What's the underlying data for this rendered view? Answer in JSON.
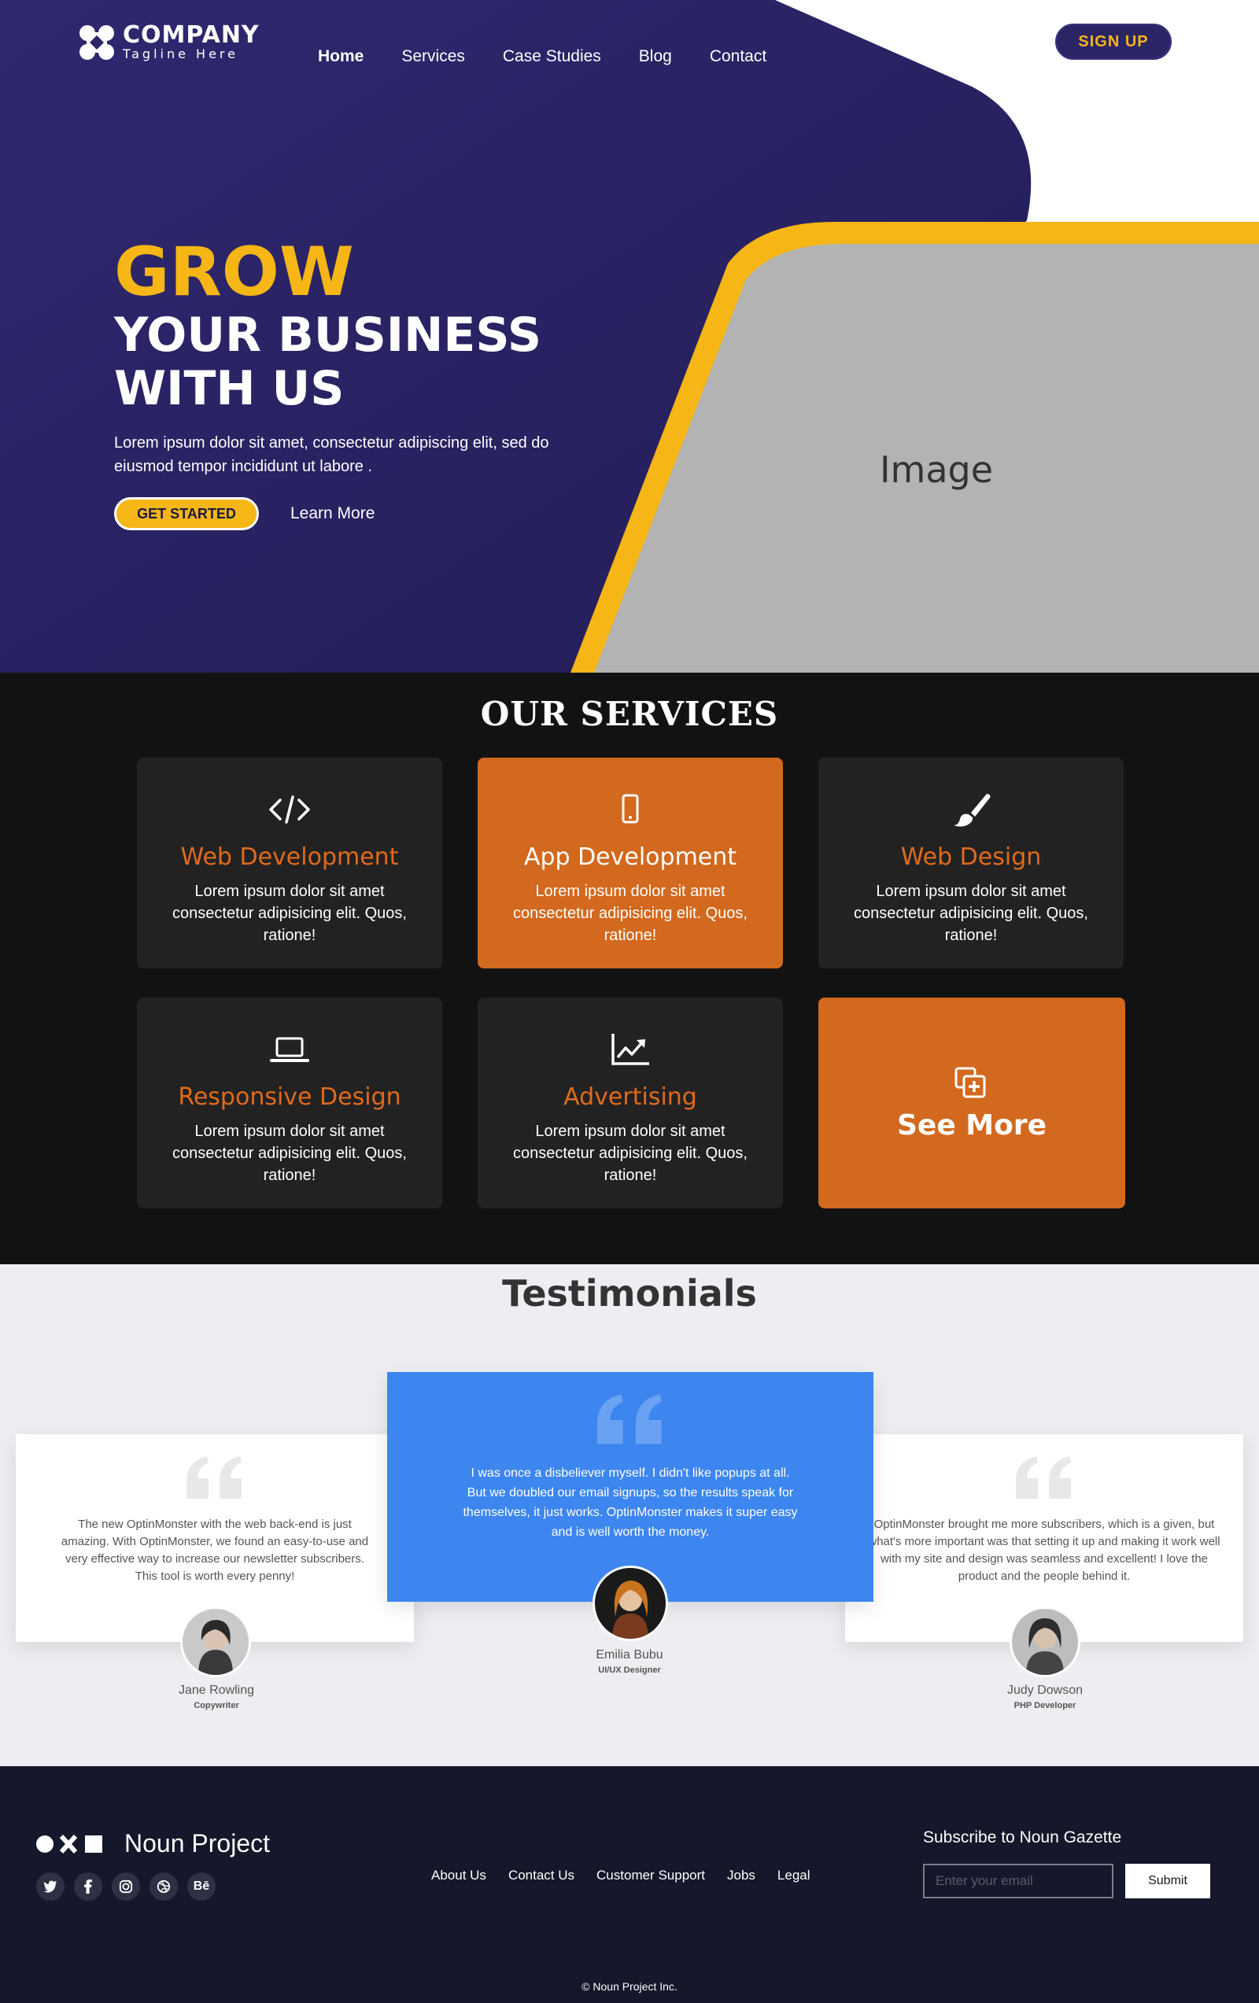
{
  "header": {
    "logo_name": "COMPANY",
    "logo_tagline": "Tagline Here",
    "nav": [
      {
        "label": "Home"
      },
      {
        "label": "Services"
      },
      {
        "label": "Case Studies"
      },
      {
        "label": "Blog"
      },
      {
        "label": "Contact"
      }
    ],
    "signup_label": "SIGN UP"
  },
  "hero": {
    "headline_accent": "GROW",
    "headline_line1": "YOUR BUSINESS",
    "headline_line2": "WITH US",
    "description": "Lorem ipsum dolor sit amet, consectetur adipiscing elit, sed do eiusmod tempor incididunt ut labore .",
    "primary_cta": "GET STARTED",
    "secondary_cta": "Learn More",
    "image_placeholder": "Image"
  },
  "services": {
    "title": "OUR SERVICES",
    "cards": [
      {
        "title": "Web Development",
        "description": "Lorem ipsum dolor sit amet consectetur adipisicing elit. Quos, ratione!",
        "icon": "code-icon"
      },
      {
        "title": "App Development",
        "description": "Lorem ipsum dolor sit amet consectetur adipisicing elit. Quos, ratione!",
        "icon": "mobile-icon"
      },
      {
        "title": "Web Design",
        "description": "Lorem ipsum dolor sit amet consectetur adipisicing elit. Quos, ratione!",
        "icon": "paintbrush-icon"
      },
      {
        "title": "Responsive Design",
        "description": "Lorem ipsum dolor sit amet consectetur adipisicing elit. Quos, ratione!",
        "icon": "laptop-icon"
      },
      {
        "title": "Advertising",
        "description": "Lorem ipsum dolor sit amet consectetur adipisicing elit. Quos, ratione!",
        "icon": "chart-line-icon"
      }
    ],
    "see_more_label": "See More"
  },
  "testimonials": {
    "title": "Testimonials",
    "items": [
      {
        "text": "The new OptinMonster with the web back-end is just amazing. With OptinMonster, we found an easy-to-use and very effective way to increase our newsletter subscribers. This tool is worth every penny!",
        "name": "Jane Rowling",
        "role": "Copywriter"
      },
      {
        "text": "I was once a disbeliever myself. I didn't like popups at all. But we doubled our email signups, so the results speak for themselves, it just works. OptinMonster makes it super easy and is well worth the money.",
        "name": "Emilia Bubu",
        "role": "UI/UX Designer"
      },
      {
        "text": "OptinMonster brought me more subscribers, which is a given, but what's more important was that setting it up and making it work well with my site and design was seamless and excellent! I love the product and the people behind it.",
        "name": "Judy Dowson",
        "role": "PHP Developer"
      }
    ]
  },
  "footer": {
    "brand": "Noun Project",
    "socials": [
      "twitter-icon",
      "facebook-icon",
      "instagram-icon",
      "dribbble-icon",
      "behance-icon"
    ],
    "behance_text": "Bē",
    "links": [
      "About Us",
      "Contact Us",
      "Customer Support",
      "Jobs",
      "Legal"
    ],
    "subscribe_title": "Subscribe to Noun Gazette",
    "email_placeholder": "Enter your email",
    "submit_label": "Submit",
    "copyright": "© Noun Project Inc."
  },
  "colors": {
    "hero_navy": "#2b2566",
    "accent_yellow": "#f5b616",
    "service_orange": "#d2691e",
    "testimonial_blue": "#3d86ef",
    "footer_navy": "#15172a"
  }
}
